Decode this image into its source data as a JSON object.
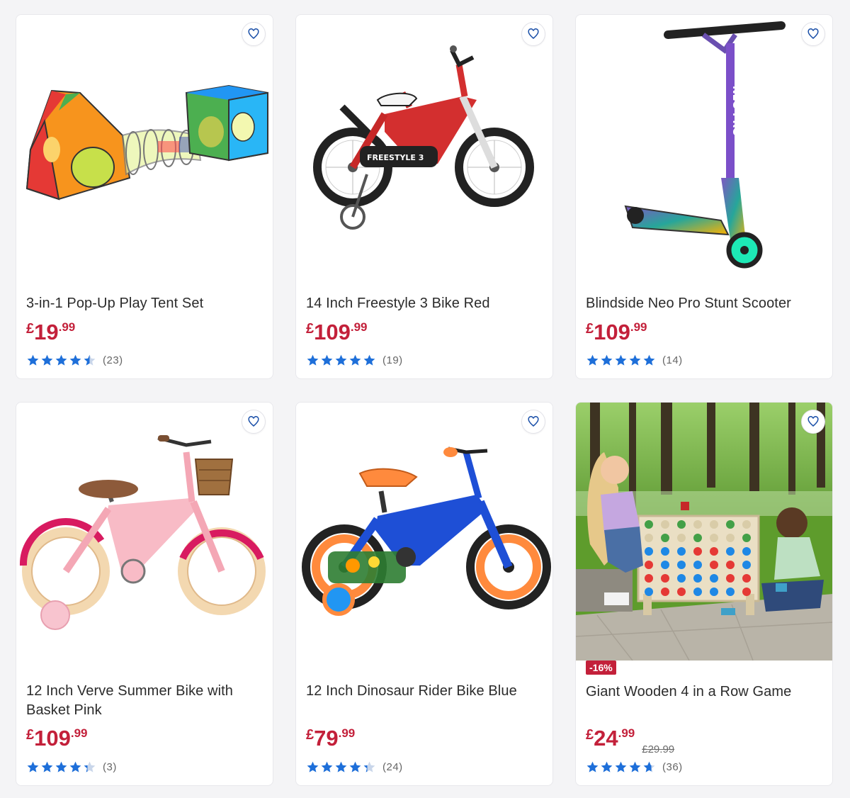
{
  "colors": {
    "price": "#c3203a",
    "star": "#1e6fd9",
    "star_empty": "#c9d6ea",
    "badge": "#c3203a"
  },
  "products": [
    {
      "title": "3-in-1 Pop-Up Play Tent Set",
      "price": {
        "currency": "£",
        "pounds": "19",
        "pence": ".99"
      },
      "rating": 4.5,
      "reviews": "(23)",
      "wishlist_icon": "heart-outline-icon"
    },
    {
      "title": "14 Inch Freestyle 3 Bike Red",
      "price": {
        "currency": "£",
        "pounds": "109",
        "pence": ".99"
      },
      "rating": 5,
      "reviews": "(19)",
      "wishlist_icon": "heart-outline-icon"
    },
    {
      "title": "Blindside Neo Pro Stunt Scooter",
      "price": {
        "currency": "£",
        "pounds": "109",
        "pence": ".99"
      },
      "rating": 5,
      "reviews": "(14)",
      "wishlist_icon": "heart-outline-icon"
    },
    {
      "title": "12 Inch Verve Summer Bike with Basket Pink",
      "price": {
        "currency": "£",
        "pounds": "109",
        "pence": ".99"
      },
      "rating": 4.3,
      "reviews": "(3)",
      "wishlist_icon": "heart-outline-icon"
    },
    {
      "title": "12 Inch Dinosaur Rider Bike Blue",
      "price": {
        "currency": "£",
        "pounds": "79",
        "pence": ".99"
      },
      "rating": 4.3,
      "reviews": "(24)",
      "wishlist_icon": "heart-outline-icon"
    },
    {
      "title": "Giant Wooden 4 in a Row Game",
      "badge": "-16%",
      "price": {
        "currency": "£",
        "pounds": "24",
        "pence": ".99"
      },
      "was_price": "£29.99",
      "rating": 4.7,
      "reviews": "(36)",
      "wishlist_icon": "heart-outline-icon"
    }
  ]
}
